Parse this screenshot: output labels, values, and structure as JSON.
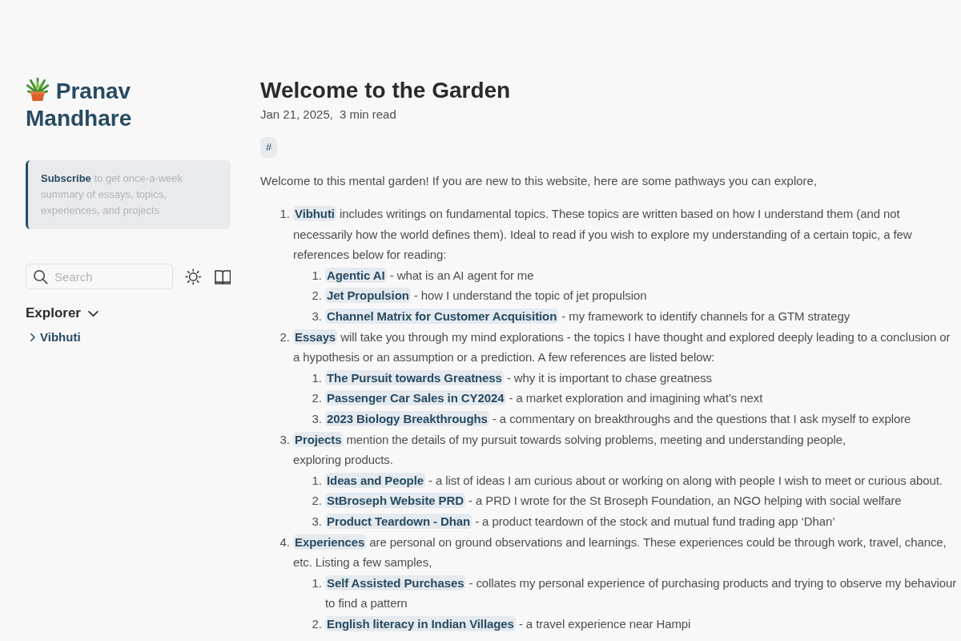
{
  "sidebar": {
    "title": "Pranav Mandhare",
    "subscribe": {
      "link": "Subscribe",
      "text": "to get once-a-week summary of essays, topics, experiences, and projects"
    },
    "search": {
      "placeholder": "Search"
    },
    "explorer": {
      "title": "Explorer",
      "expanded": true,
      "items": [
        {
          "label": "Vibhuti",
          "expanded": false
        }
      ]
    }
  },
  "article": {
    "title": "Welcome to the Garden",
    "date": "Jan 21, 2025,",
    "reading_time": "3 min read",
    "tags": [
      "#"
    ],
    "intro": "Welcome to this mental garden! If you are new to this website, here are some pathways you can explore,",
    "list": [
      {
        "number": "1.",
        "link": "Vibhuti",
        "text": "includes writings on fundamental topics. These topics are written based on how I understand them (and not necessarily how the world defines them). Ideal to read if you wish to explore my understanding of a certain topic, a few references below for reading:",
        "children": [
          {
            "number": "1.",
            "link": "Agentic AI",
            "text": "- what is an AI agent for me"
          },
          {
            "number": "2.",
            "link": "Jet Propulsion",
            "text": "- how I understand the topic of jet propulsion"
          },
          {
            "number": "3.",
            "link": "Channel Matrix for Customer Acquisition",
            "text": "- my framework to identify channels for a GTM strategy"
          }
        ]
      },
      {
        "number": "2.",
        "link": "Essays",
        "text": "will take you through my mind explorations - the topics I have thought and explored deeply leading to a conclusion or a hypothesis or an assumption or a prediction. A few references are listed below:",
        "children": [
          {
            "number": "1.",
            "link": "The Pursuit towards Greatness",
            "text": "- why it is important to chase greatness"
          },
          {
            "number": "2.",
            "link": "Passenger Car Sales in CY2024",
            "text": "- a market exploration and imagining what’s next"
          },
          {
            "number": "3.",
            "link": "2023 Biology Breakthroughs",
            "text": "- a commentary on breakthroughs and the questions that I ask myself to explore"
          }
        ]
      },
      {
        "number": "3.",
        "link": "Projects",
        "text": "mention the details of my pursuit towards solving problems, meeting and understanding people,\nexploring products.",
        "children": [
          {
            "number": "1.",
            "link": "Ideas and People",
            "text": "- a list of ideas I am curious about or working on along with people I wish to meet or curious about."
          },
          {
            "number": "2.",
            "link": "StBroseph Website PRD",
            "text": "- a PRD I wrote for the St Broseph Foundation, an NGO helping with social welfare"
          },
          {
            "number": "3.",
            "link": "Product Teardown - Dhan",
            "text": "- a product teardown of the stock and mutual fund trading app ‘Dhan’"
          }
        ]
      },
      {
        "number": "4.",
        "link": "Experiences",
        "text": "are personal on ground observations and learnings. These experiences could be through work, travel, chance, etc. Listing a few samples,",
        "children": [
          {
            "number": "1.",
            "link": "Self Assisted Purchases",
            "text": "- collates my personal experience of purchasing products and trying to observe my behaviour to find a pattern"
          },
          {
            "number": "2.",
            "link": "English literacy in Indian Villages",
            "text": "- a travel experience near Hampi"
          }
        ]
      }
    ]
  }
}
